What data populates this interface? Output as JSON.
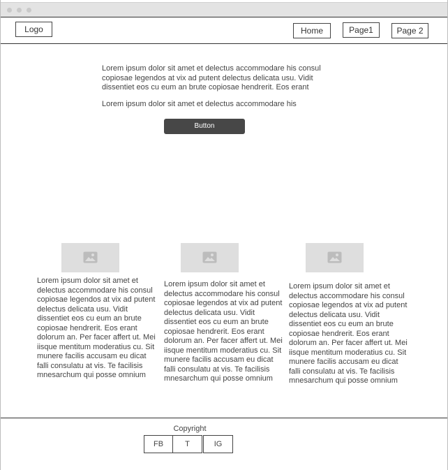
{
  "header": {
    "logo": "Logo",
    "nav": [
      "Home",
      "Page1",
      "Page 2"
    ]
  },
  "hero": {
    "paragraph1": "Lorem ipsum dolor sit amet et delectus accommodare his consul copiosae legendos at vix ad putent delectus delicata usu. Vidit dissentiet eos cu eum an brute copiosae hendrerit. Eos erant",
    "paragraph2": "Lorem ipsum dolor sit amet et delectus accommodare his",
    "button": "Button"
  },
  "columns": [
    {
      "icon": "image-icon",
      "text": "Lorem ipsum dolor sit amet et delectus accommodare his consul copiosae legendos at vix ad putent delectus delicata usu. Vidit dissentiet eos cu eum an brute copiosae hendrerit. Eos erant dolorum an. Per facer affert ut. Mei iisque mentitum moderatius cu. Sit munere facilis accusam eu dicat falli consulatu at vis. Te facilisis mnesarchum qui posse omnium"
    },
    {
      "icon": "image-icon",
      "text": "Lorem ipsum dolor sit amet et delectus accommodare his consul copiosae legendos at vix ad putent delectus delicata usu. Vidit dissentiet eos cu eum an brute copiosae hendrerit. Eos erant dolorum an. Per facer affert ut. Mei iisque mentitum moderatius cu. Sit munere facilis accusam eu dicat falli consulatu at vis. Te facilisis mnesarchum qui posse omnium"
    },
    {
      "icon": "image-icon",
      "text": "Lorem ipsum dolor sit amet et delectus accommodare his consul copiosae legendos at vix ad putent delectus delicata usu. Vidit dissentiet eos cu eum an brute copiosae hendrerit. Eos erant dolorum an. Per facer affert ut. Mei iisque mentitum moderatius cu. Sit munere facilis accusam eu dicat falli consulatu at vis. Te facilisis mnesarchum qui posse omnium"
    }
  ],
  "footer": {
    "copyright": "Copyright",
    "social": [
      "FB",
      "T",
      "IG"
    ]
  }
}
